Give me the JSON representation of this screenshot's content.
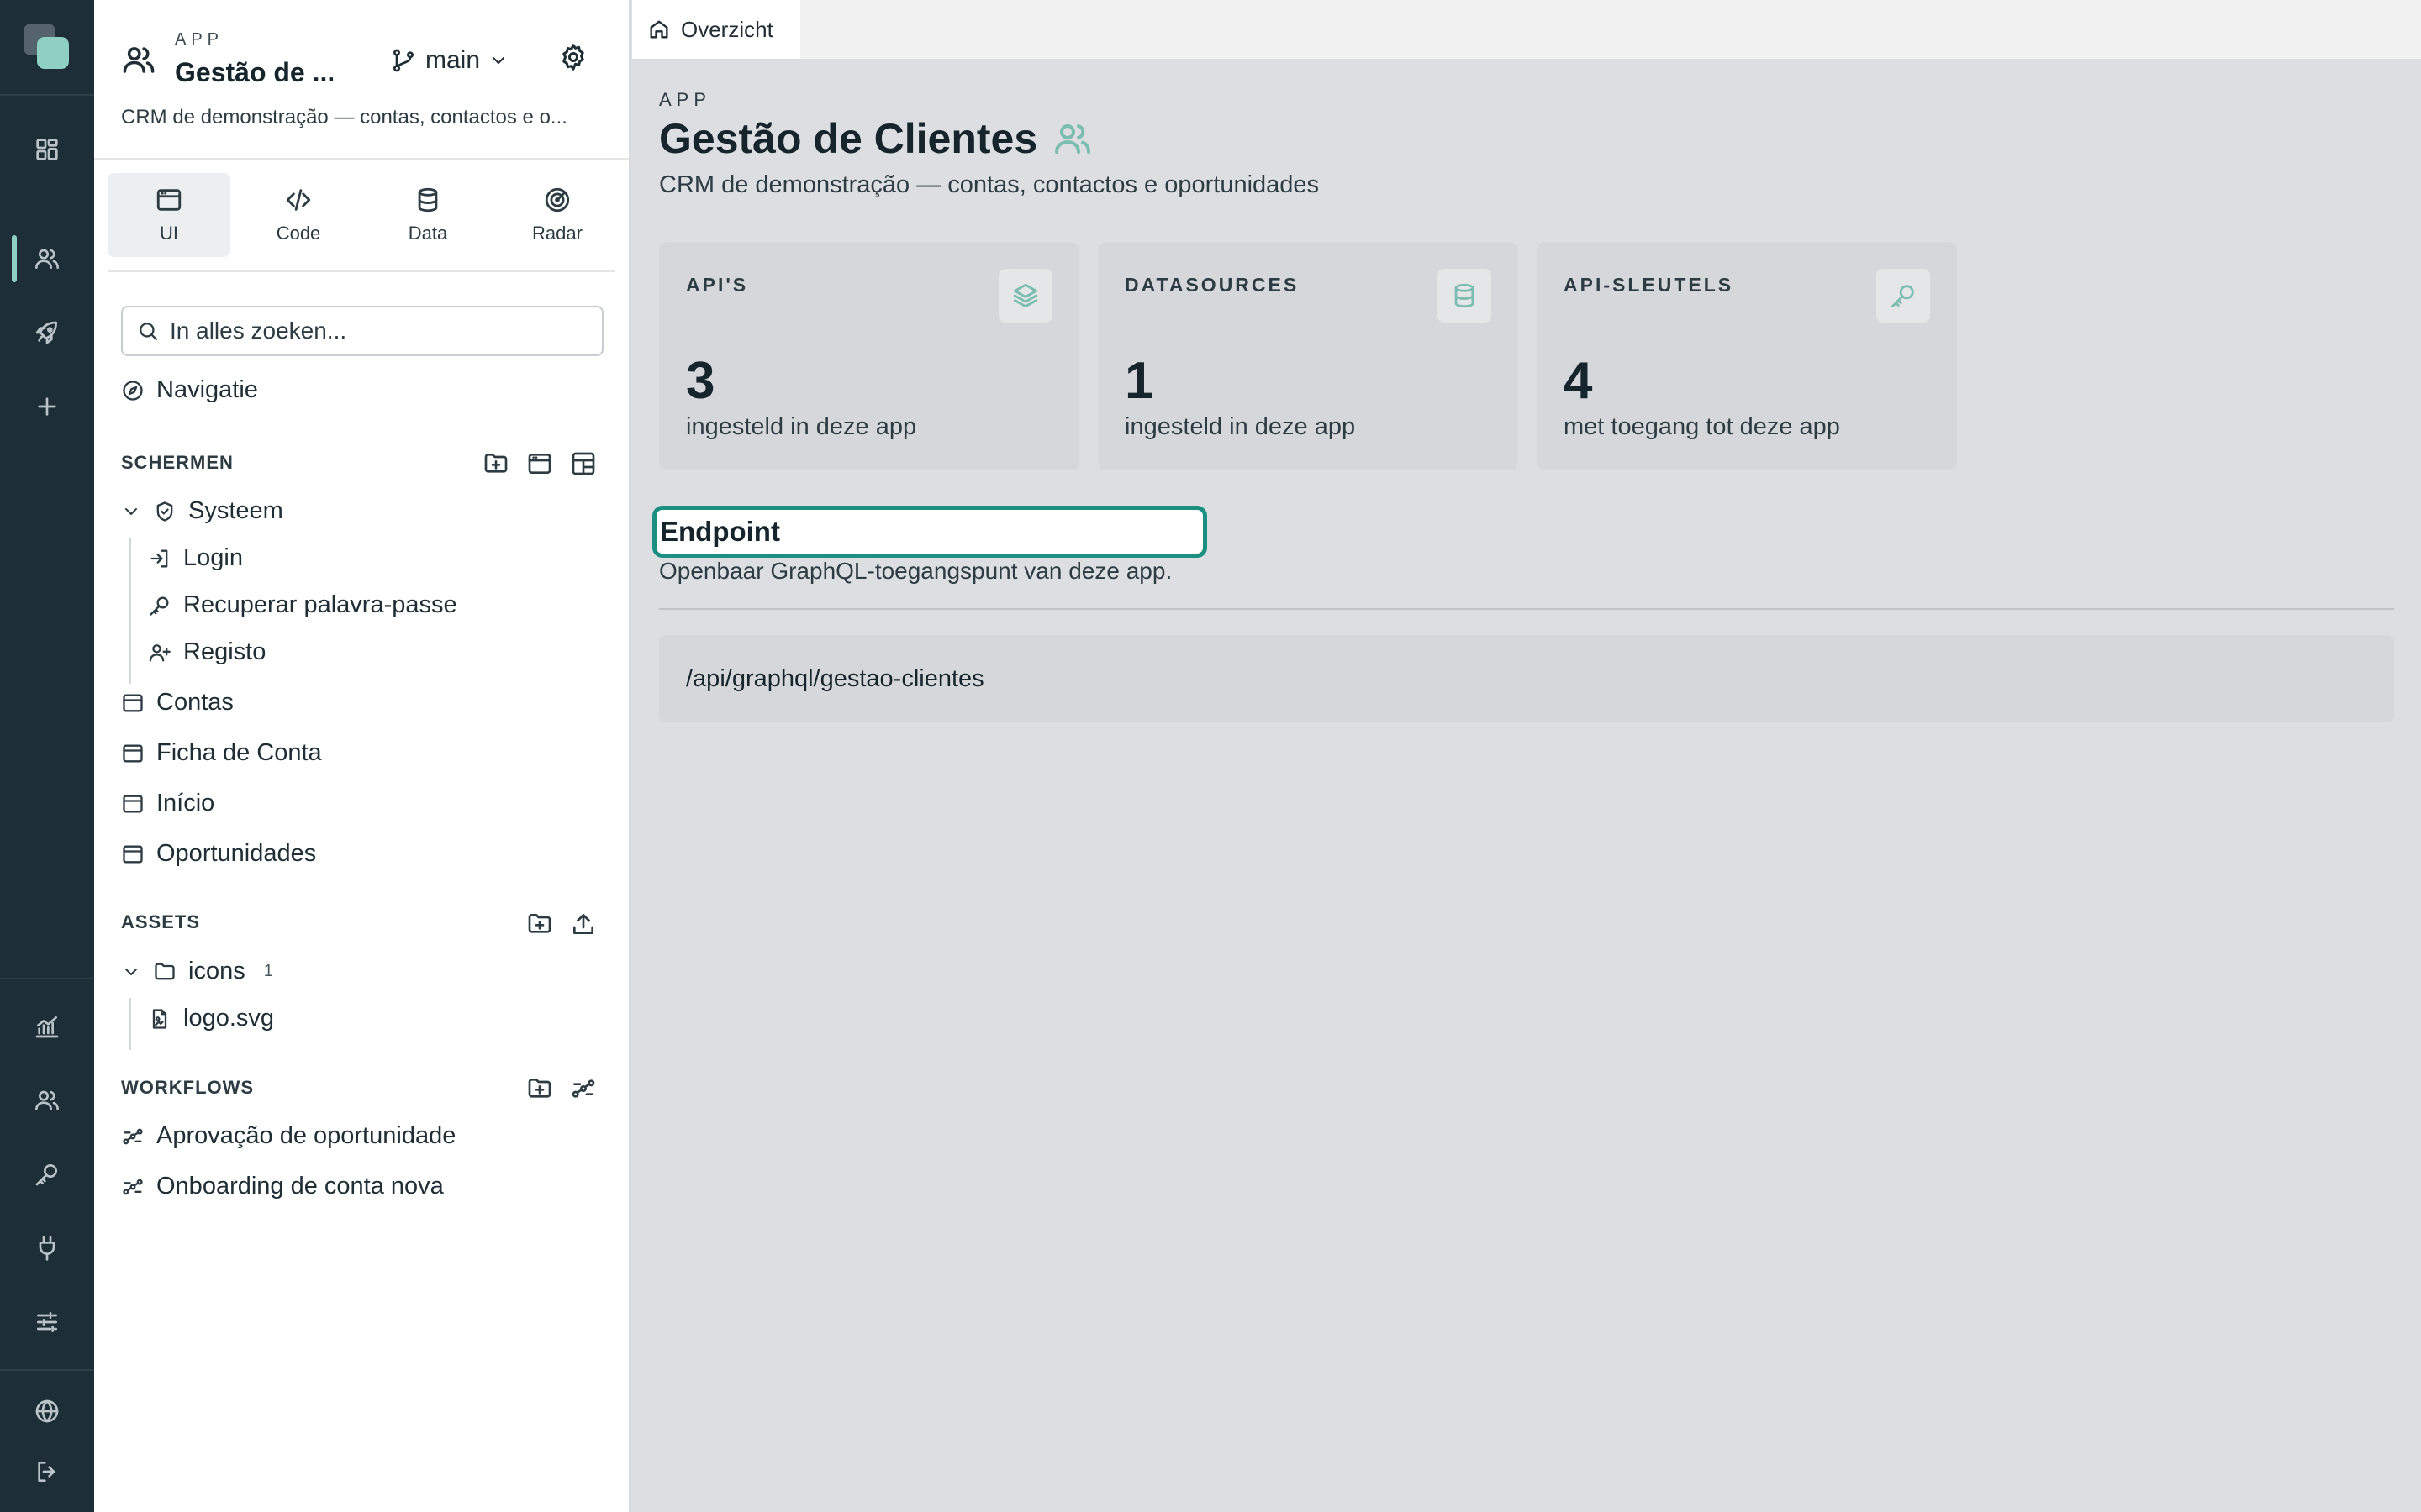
{
  "app": {
    "label": "APP",
    "title_truncated": "Gestão de ...",
    "branch": "main",
    "description": "CRM de demonstração — contas, contactos e o..."
  },
  "tabs": [
    {
      "label": "UI",
      "icon": "window-icon",
      "active": true
    },
    {
      "label": "Code",
      "icon": "code-icon",
      "active": false
    },
    {
      "label": "Data",
      "icon": "database-icon",
      "active": false
    },
    {
      "label": "Radar",
      "icon": "radar-icon",
      "active": false
    }
  ],
  "search": {
    "placeholder": "In alles zoeken..."
  },
  "navigation_label": "Navigatie",
  "screens": {
    "title": "SCHERMEN",
    "system_folder": "Systeem",
    "system_items": [
      "Login",
      "Recuperar palavra-passe",
      "Registo"
    ],
    "items": [
      "Contas",
      "Ficha de Conta",
      "Início",
      "Oportunidades"
    ]
  },
  "assets": {
    "title": "ASSETS",
    "folder": "icons",
    "folder_count": "1",
    "files": [
      "logo.svg"
    ]
  },
  "workflows": {
    "title": "WORKFLOWS",
    "items": [
      "Aprovação de oportunidade",
      "Onboarding de conta nova"
    ]
  },
  "breadcrumb": {
    "tab": "Overzicht"
  },
  "main": {
    "app_label": "APP",
    "title": "Gestão de Clientes",
    "description": "CRM de demonstração — contas, contactos e oportunidades",
    "cards": [
      {
        "label": "API'S",
        "value": "3",
        "sub": "ingesteld in deze app",
        "icon": "layers-icon"
      },
      {
        "label": "DATASOURCES",
        "value": "1",
        "sub": "ingesteld in deze app",
        "icon": "database-icon"
      },
      {
        "label": "API-SLEUTELS",
        "value": "4",
        "sub": "met toegang tot deze app",
        "icon": "key-icon"
      }
    ],
    "endpoint": {
      "title": "Endpoint",
      "description": "Openbaar GraphQL-toegangspunt van deze app.",
      "path": "/api/graphql/gestao-clientes"
    }
  },
  "colors": {
    "rail_bg": "#1e2e37",
    "accent": "#8fd0c4",
    "focus_ring": "#1a8f82",
    "main_bg": "#dddee1"
  }
}
